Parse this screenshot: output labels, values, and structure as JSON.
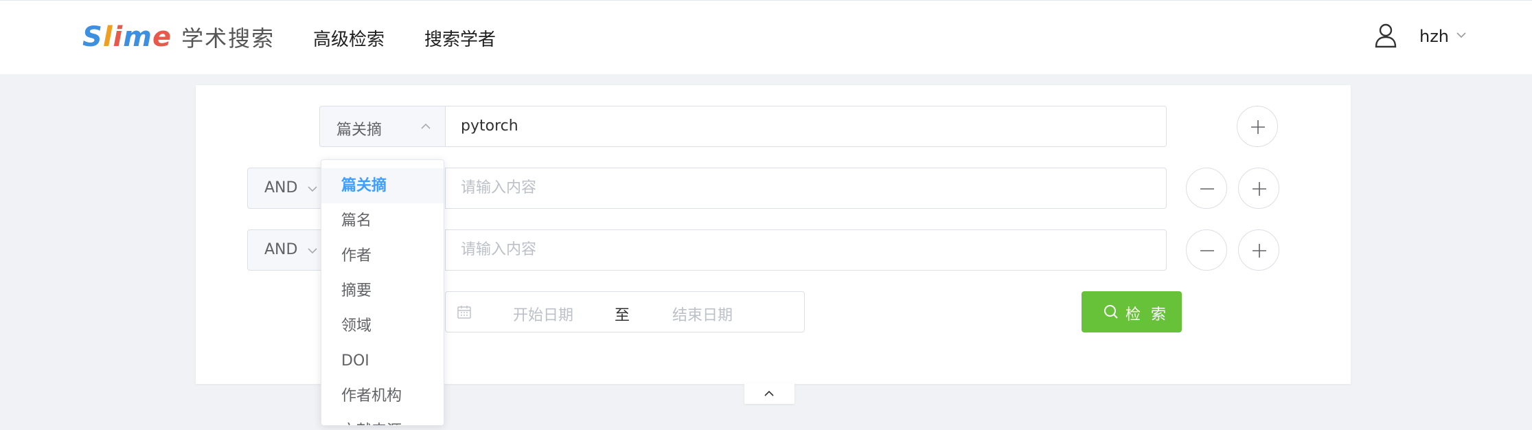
{
  "header": {
    "logo_text": "Slime",
    "site_name": "学术搜索",
    "nav": [
      "高级检索",
      "搜索学者"
    ],
    "username": "hzh"
  },
  "search": {
    "rows": [
      {
        "field": "篇关摘",
        "value": "pytorch",
        "placeholder": ""
      },
      {
        "operator": "AND",
        "field": "",
        "value": "",
        "placeholder": "请输入内容"
      },
      {
        "operator": "AND",
        "field": "",
        "value": "",
        "placeholder": "请输入内容"
      }
    ],
    "date_range": {
      "start_placeholder": "开始日期",
      "separator": "至",
      "end_placeholder": "结束日期"
    },
    "search_button": "检 索"
  },
  "field_dropdown": {
    "selected": "篇关摘",
    "options": [
      "篇关摘",
      "篇名",
      "作者",
      "摘要",
      "领域",
      "DOI",
      "作者机构",
      "文献来源"
    ]
  },
  "colors": {
    "primary": "#409eff",
    "success": "#67c23a",
    "background": "#f1f2f6"
  },
  "icons": [
    "user-icon",
    "chevron-down-icon",
    "chevron-up-icon",
    "plus-icon",
    "minus-icon",
    "calendar-icon",
    "search-icon"
  ]
}
